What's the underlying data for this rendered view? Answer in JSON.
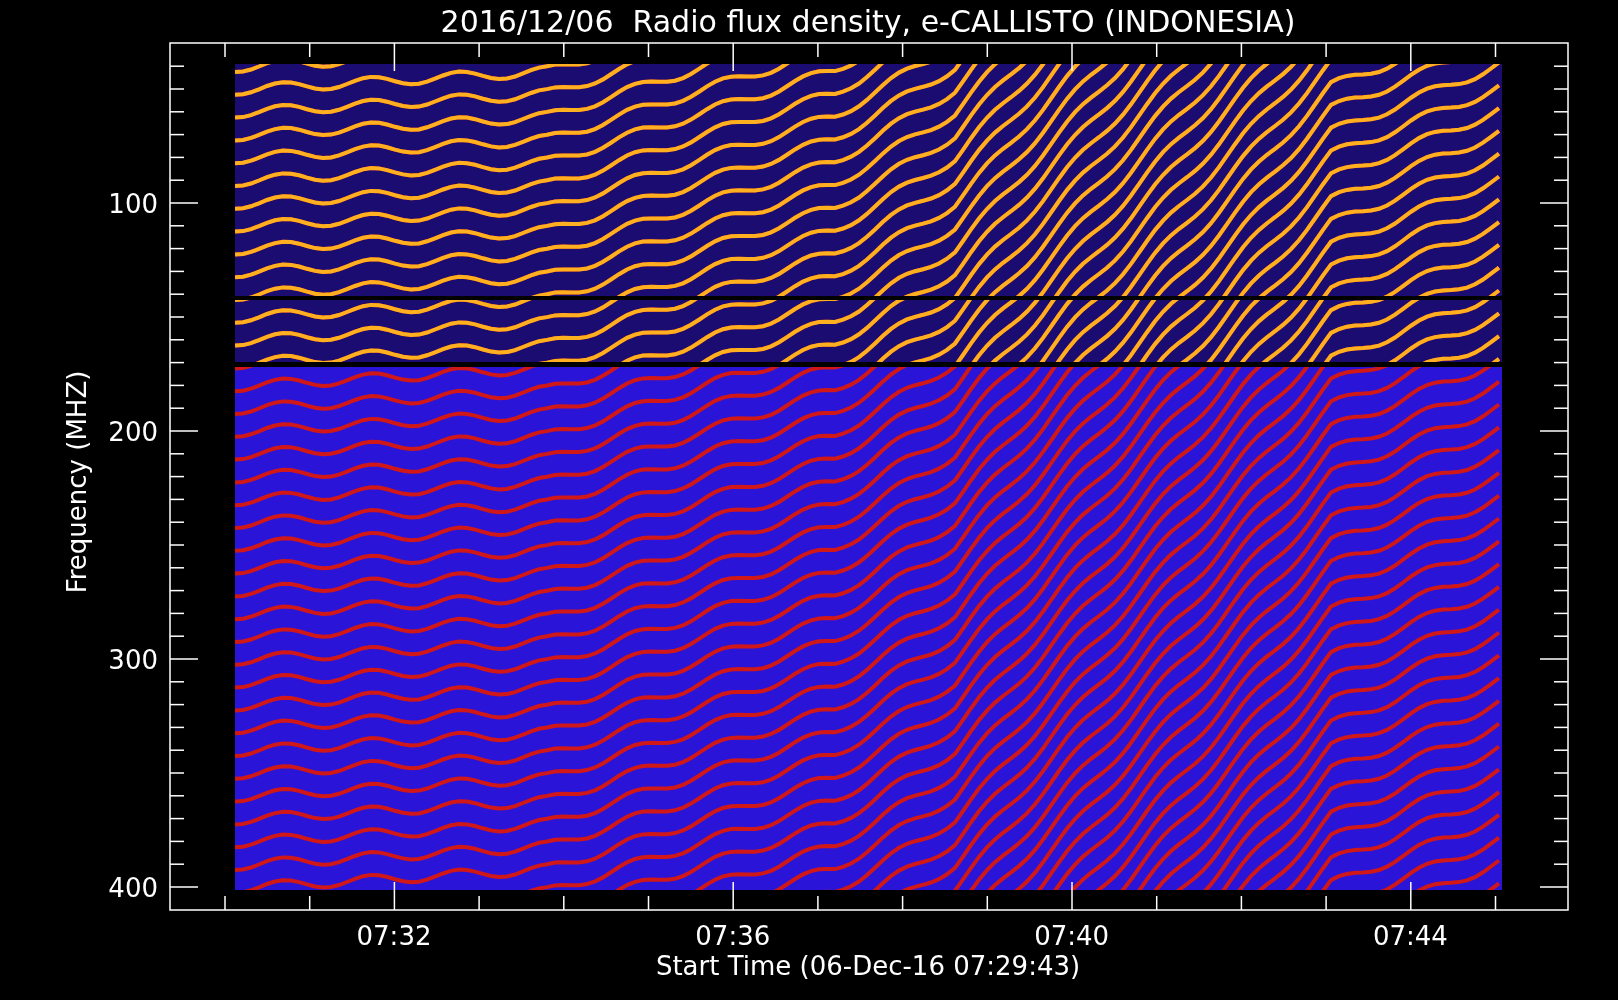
{
  "title": "2016/12/06  Radio flux density, e-CALLISTO (INDONESIA)",
  "ylabel": "Frequency (MHZ)",
  "xlabel": "Start Time (06-Dec-16 07:29:43)",
  "yticks": [
    {
      "label": "100"
    },
    {
      "label": "200"
    },
    {
      "label": "300"
    },
    {
      "label": "400"
    }
  ],
  "xticks": [
    {
      "label": "07:32"
    },
    {
      "label": "07:36"
    },
    {
      "label": "07:40"
    },
    {
      "label": "07:44"
    }
  ]
}
